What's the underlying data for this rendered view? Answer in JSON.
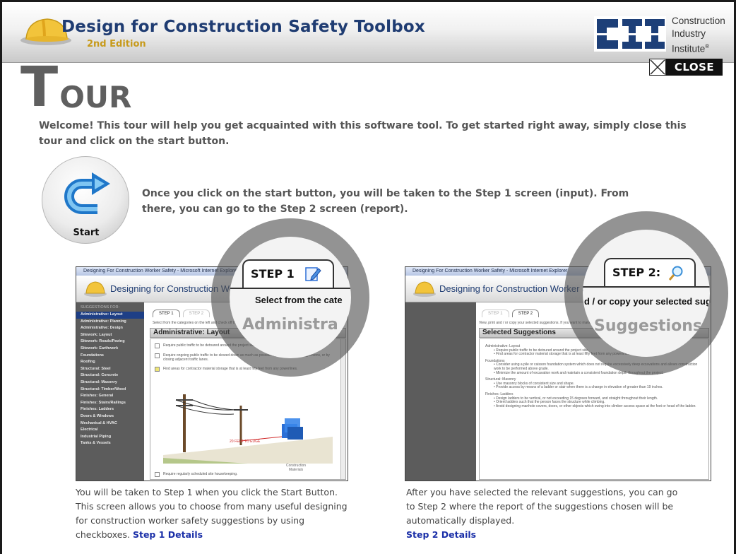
{
  "header": {
    "title": "Design for Construction Safety Toolbox",
    "edition": "2nd Edition",
    "cii_line1": "Construction",
    "cii_line2": "Industry",
    "cii_line3": "Institute",
    "cii_reg": "®"
  },
  "close_label": "CLOSE",
  "tour": {
    "big_letter": "T",
    "rest": "OUR",
    "intro": "Welcome! This tour will help you get acquainted with this software tool. To get started right away, simply close this tour and click on the start button.",
    "start_label": "Start",
    "start_description": "Once you click on the start button, you will be taken to the Step 1 screen (input). From there, you can go to the Step 2 screen (report)."
  },
  "step1": {
    "window_title": "Designing For Construction Worker Safety - Microsoft Internet Explorer",
    "app_title": "Designing for Construction Worker Safety",
    "sidebar_label": "SUGGESTIONS FOR:",
    "sidebar_items": [
      "Administrative: Layout",
      "Administrative: Planning",
      "Administrative: Design",
      "Sitework: Layout",
      "Sitework: Roads/Paving",
      "Sitework: Earthwork",
      "Foundations",
      "Roofing",
      "Structural: Steel",
      "Structural: Concrete",
      "Structural: Masonry",
      "Structural: Timber/Wood",
      "Finishes: General",
      "Finishes: Stairs/Railings",
      "Finishes: Ladders",
      "Doors & Windows",
      "Mechanical & HVAC",
      "Electrical",
      "Industrial Piping",
      "Tanks & Vessels"
    ],
    "tab_step1": "STEP 1",
    "tab_step2": "STEP 2",
    "instructions": "Select from the categories on the left and check off the relevant suggestions",
    "panel_title": "Administrative: Layout",
    "checkboxes": [
      "Require public traffic to be detoured around the project site.",
      "Require ongoing public traffic to be slowed down as much as possible by using flaggers, flagpersons, or by closing adjacent traffic lanes.",
      "Find areas for contractor material storage that is at least fifty feet from any powerlines."
    ],
    "last_checkbox": "Require regularly scheduled site housekeeping.",
    "illus_label1": "20 FEET TO EDGE",
    "illus_label2": "Construction Materials",
    "mag_step": "STEP 1",
    "mag_text": "Select from the cate",
    "mag_ghost": "Administra",
    "caption": "You will be taken to Step 1 when you click the Start Button. This screen allows you to choose from many useful designing for construction worker safety suggestions by using checkboxes.",
    "link": "Step 1 Details"
  },
  "step2": {
    "window_title": "Designing For Construction Worker Safety - Microsoft Internet Explorer",
    "app_title": "Designing for Construction Worker Safety",
    "tab_step1": "STEP 1",
    "tab_step2": "STEP 2",
    "instructions": "View, print and / or copy your selected suggestions. If you want to make changes, go back to Step 1.",
    "panel_title": "Selected Suggestions",
    "sections": [
      {
        "title": "Administrative: Layout",
        "bullets": [
          "Require public traffic to be detoured around the project site.",
          "Find areas for contractor material storage that is at least fifty feet from any powerlines."
        ]
      },
      {
        "title": "Foundations",
        "bullets": [
          "Consider using a pile or caisson foundation system which does not require excessively deep excavations and allows construction work to be performed above grade.",
          "Minimize the amount of excavation work and maintain a consistent foundation depth throughout the project."
        ]
      },
      {
        "title": "Structural: Masonry",
        "bullets": [
          "Use masonry blocks of consistent size and shape.",
          "Provide access by means of a ladder or stair when there is a change in elevation of greater than 19 inches."
        ]
      },
      {
        "title": "Finishes: Ladders",
        "bullets": [
          "Design ladders to be vertical, or not exceeding 15 degrees forward, and straight throughout their length.",
          "Orient ladders such that the person faces the structure while climbing.",
          "Avoid designing manhole covers, doors, or other objects which swing into climber access space at the foot or head of the ladder."
        ]
      }
    ],
    "mag_step": "STEP 2:",
    "mag_text": "d / or copy your selected sug",
    "mag_ghost": "Suggestions",
    "caption": "After you have selected the relevant suggestions, you can go to Step 2 where the report of the suggestions chosen will be automatically displayed.",
    "link": "Step 2 Details"
  },
  "colors": {
    "title_blue": "#1f3c72",
    "edition_gold": "#c79a1a",
    "heading_gray": "#5f5f5f",
    "link_blue": "#1a2fa8",
    "sidebar_bg": "#5c5c5c",
    "sidebar_active": "#1e3f86"
  }
}
